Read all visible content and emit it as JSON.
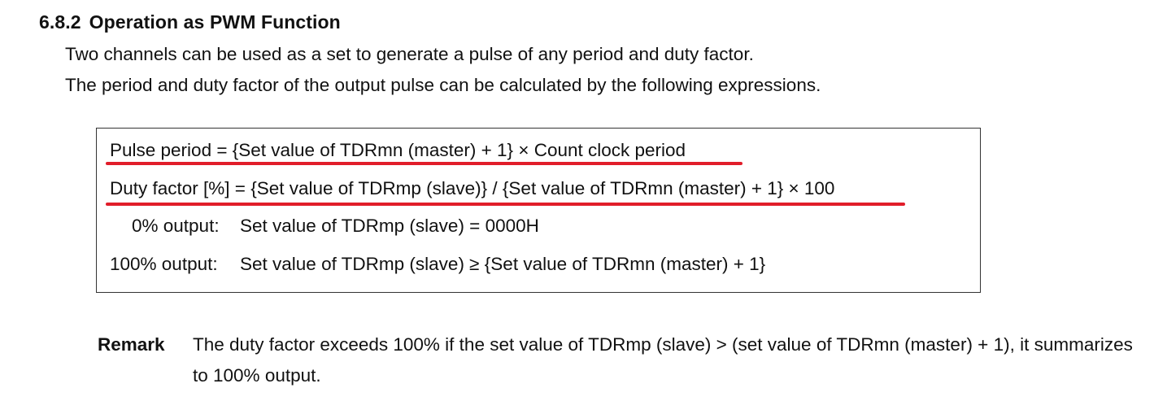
{
  "section": {
    "number": "6.8.2",
    "title": "Operation as PWM Function"
  },
  "paragraphs": [
    "Two channels can be used as a set to generate a pulse of any period and duty factor.",
    "The period and duty factor of the output pulse can be calculated by the following expressions."
  ],
  "formulas": {
    "pulse_period": "Pulse period = {Set value of TDRmn (master) + 1} × Count clock period",
    "duty_factor": "Duty factor [%] = {Set value of TDRmp (slave)} / {Set value of TDRmn (master) + 1} × 100",
    "zero_output": {
      "label": "0% output:",
      "expression": "Set value of TDRmp (slave) = 0000H"
    },
    "full_output": {
      "label": "100% output:",
      "expression": "Set value of TDRmp (slave) ≥ {Set value of TDRmn (master) + 1}"
    }
  },
  "remark": {
    "label": "Remark",
    "text": "The duty factor exceeds 100% if the set value of TDRmp (slave) > (set value of TDRmn (master) + 1), it summarizes to 100% output."
  },
  "colors": {
    "underline": "#e11d2a",
    "text": "#111111",
    "border": "#333333"
  }
}
